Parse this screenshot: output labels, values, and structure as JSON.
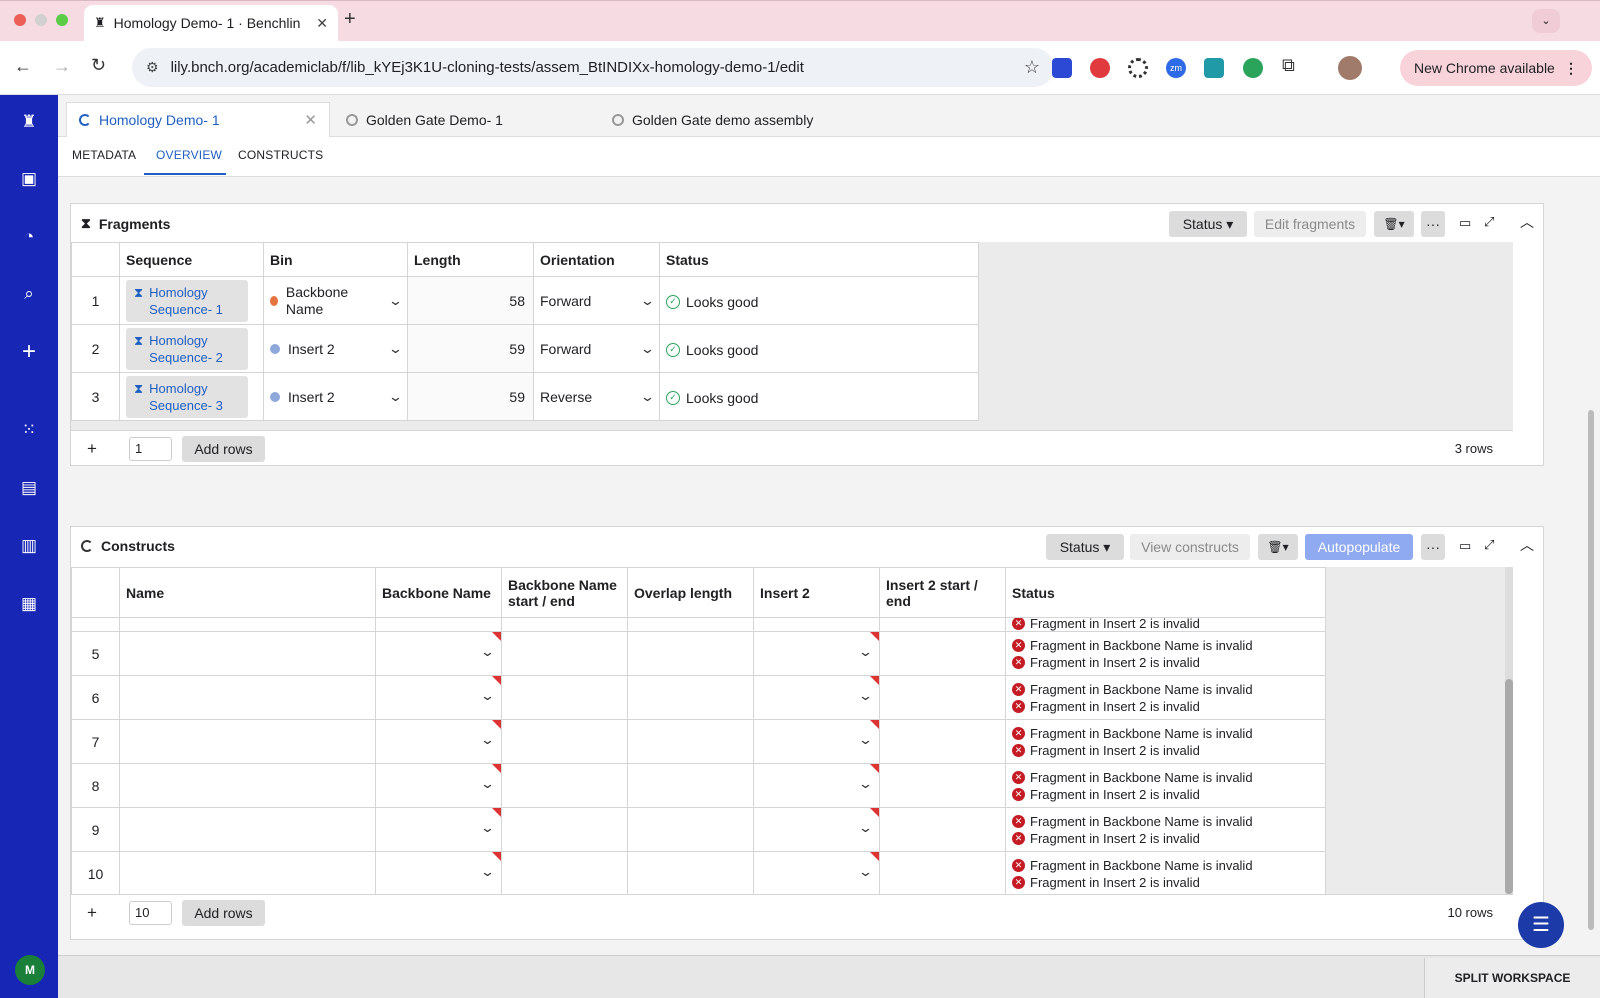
{
  "browser": {
    "tab_title": "Homology Demo- 1 · Benchlin",
    "url": "lily.bnch.org/academiclab/f/lib_kYEj3K1U-cloning-tests/assem_BtINDIXx-homology-demo-1/edit",
    "new_chrome_label": "New Chrome available"
  },
  "sidebar": {
    "avatar_initial": "M"
  },
  "app_tabs": [
    "Homology Demo- 1",
    "Golden Gate Demo- 1",
    "Golden Gate demo assembly"
  ],
  "sub_nav": [
    "METADATA",
    "OVERVIEW",
    "CONSTRUCTS"
  ],
  "fragments": {
    "title": "Fragments",
    "status_btn": "Status",
    "edit_btn": "Edit fragments",
    "columns": [
      "Sequence",
      "Bin",
      "Length",
      "Orientation",
      "Status"
    ],
    "rows": [
      {
        "n": "1",
        "seq": "Homology Sequence- 1",
        "bin": "Backbone Name",
        "bin_color": "#e6733f",
        "length": "58",
        "orientation": "Forward",
        "status": "Looks good"
      },
      {
        "n": "2",
        "seq": "Homology Sequence- 2",
        "bin": "Insert 2",
        "bin_color": "#8fa8dc",
        "length": "59",
        "orientation": "Forward",
        "status": "Looks good"
      },
      {
        "n": "3",
        "seq": "Homology Sequence- 3",
        "bin": "Insert 2",
        "bin_color": "#8fa8dc",
        "length": "59",
        "orientation": "Reverse",
        "status": "Looks good"
      }
    ],
    "add_count": "1",
    "add_label": "Add rows",
    "row_count": "3 rows"
  },
  "constructs": {
    "title": "Constructs",
    "status_btn": "Status",
    "view_btn": "View constructs",
    "autopopulate_btn": "Autopopulate",
    "columns": [
      "Name",
      "Backbone Name",
      "Backbone Name start / end",
      "Overlap length",
      "Insert 2",
      "Insert 2 start / end",
      "Status"
    ],
    "partial_status": "Fragment in Insert 2 is invalid",
    "rows": [
      {
        "n": "5",
        "err1": "Fragment in Backbone Name is invalid",
        "err2": "Fragment in Insert 2 is invalid"
      },
      {
        "n": "6",
        "err1": "Fragment in Backbone Name is invalid",
        "err2": "Fragment in Insert 2 is invalid"
      },
      {
        "n": "7",
        "err1": "Fragment in Backbone Name is invalid",
        "err2": "Fragment in Insert 2 is invalid"
      },
      {
        "n": "8",
        "err1": "Fragment in Backbone Name is invalid",
        "err2": "Fragment in Insert 2 is invalid"
      },
      {
        "n": "9",
        "err1": "Fragment in Backbone Name is invalid",
        "err2": "Fragment in Insert 2 is invalid"
      },
      {
        "n": "10",
        "err1": "Fragment in Backbone Name is invalid",
        "err2": "Fragment in Insert 2 is invalid"
      }
    ],
    "add_count": "10",
    "add_label": "Add rows",
    "row_count": "10 rows"
  },
  "footer": {
    "split_label": "SPLIT WORKSPACE"
  }
}
